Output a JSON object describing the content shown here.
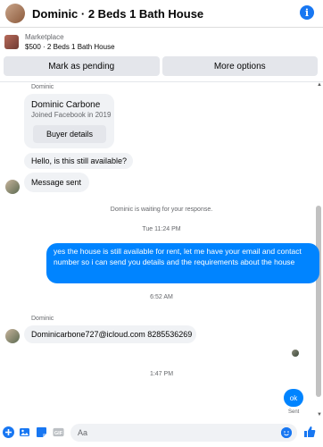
{
  "header": {
    "title": "Dominic · 2 Beds 1 Bath House",
    "info_icon": "info-icon"
  },
  "listing": {
    "marketplace_label": "Marketplace",
    "detail": "$500 · 2 Beds 1 Bath House"
  },
  "actions": {
    "mark_pending": "Mark as pending",
    "more_options": "More options"
  },
  "conversation": {
    "sender_top": "Dominic",
    "card": {
      "name": "Dominic Carbone",
      "joined": "Joined Facebook in 2019",
      "button": "Buyer details"
    },
    "msg1": "Hello, is this still available?",
    "msg2": "Message sent",
    "waiting": "Dominic is waiting for your response.",
    "time1": "Tue 11:24 PM",
    "outgoing": "yes the house is still available for rent, let me have your email  and contact number so i can send you details and the requirements about the house",
    "time2": "6:52 AM",
    "sender_mid": "Dominic",
    "msg3": "Dominicarbone727@icloud.com 8285536269",
    "time3": "1:47 PM",
    "ok": "ok",
    "sent": "Sent"
  },
  "composer": {
    "placeholder": "Aa"
  },
  "colors": {
    "accent": "#0084ff",
    "brand": "#1877f2",
    "bubble_in": "#f0f2f5"
  }
}
